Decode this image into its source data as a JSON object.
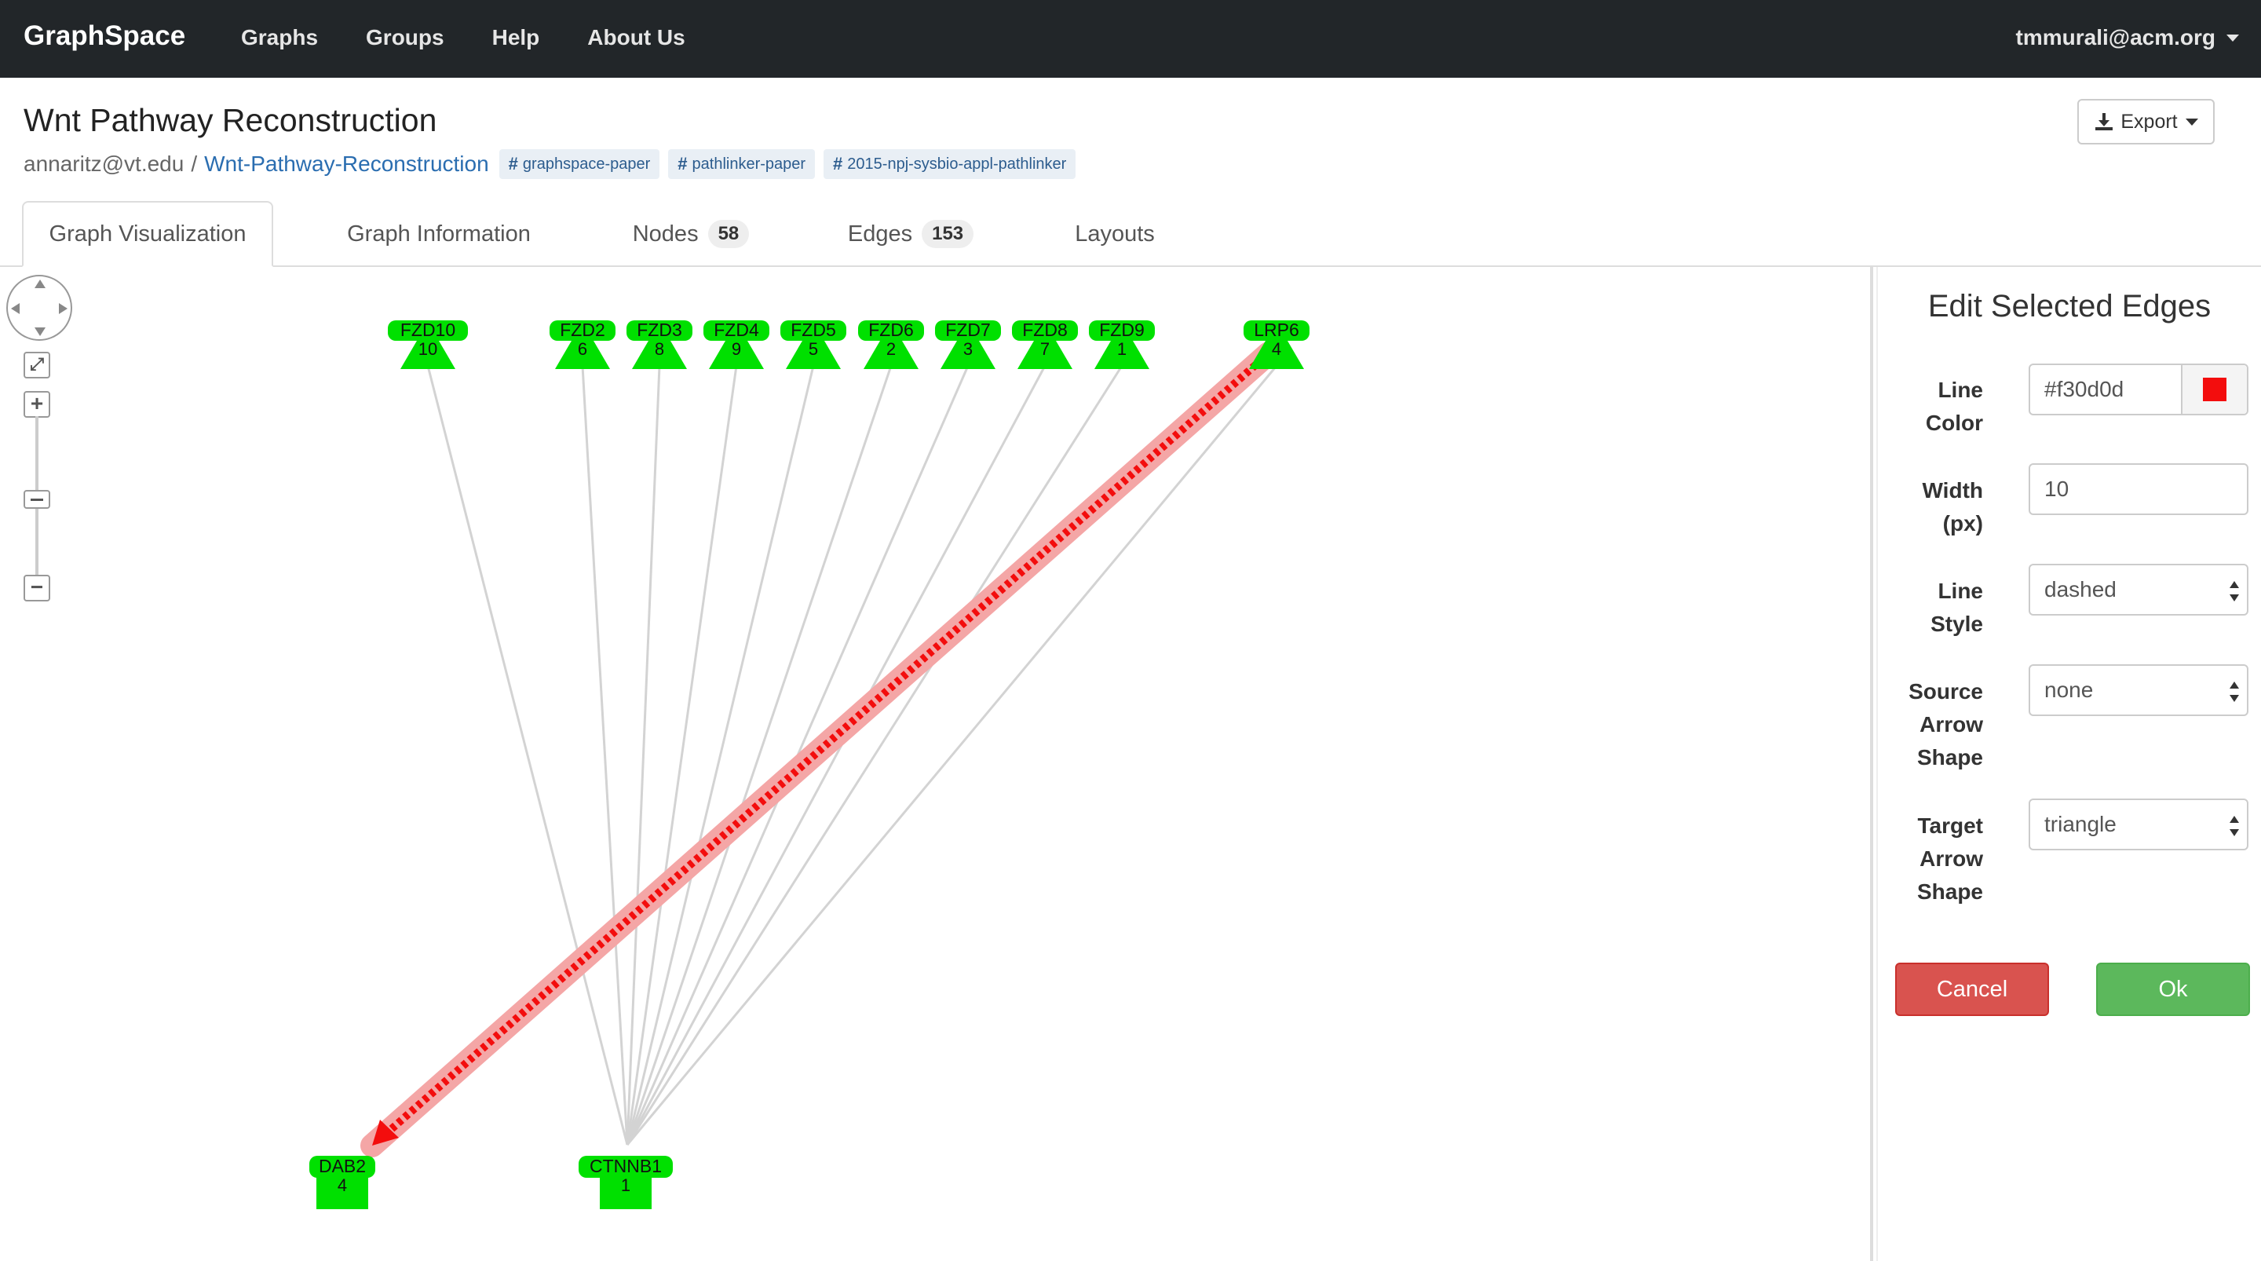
{
  "navbar": {
    "brand": "GraphSpace",
    "links": [
      "Graphs",
      "Groups",
      "Help",
      "About Us"
    ],
    "user": "tmmurali@acm.org"
  },
  "header": {
    "title": "Wnt Pathway Reconstruction",
    "owner": "annaritz@vt.edu",
    "separator": "/",
    "graph_name": "Wnt-Pathway-Reconstruction",
    "tags": [
      "graphspace-paper",
      "pathlinker-paper",
      "2015-npj-sysbio-appl-pathlinker"
    ],
    "export_label": "Export"
  },
  "tabs": [
    {
      "label": "Graph Visualization",
      "count": null
    },
    {
      "label": "Graph Information",
      "count": null
    },
    {
      "label": "Nodes",
      "count": "58"
    },
    {
      "label": "Edges",
      "count": "153"
    },
    {
      "label": "Layouts",
      "count": null
    }
  ],
  "graph": {
    "receptors": [
      {
        "name": "FZD10",
        "rank": "10"
      },
      {
        "name": "FZD2",
        "rank": "6"
      },
      {
        "name": "FZD3",
        "rank": "8"
      },
      {
        "name": "FZD4",
        "rank": "9"
      },
      {
        "name": "FZD5",
        "rank": "5"
      },
      {
        "name": "FZD6",
        "rank": "2"
      },
      {
        "name": "FZD7",
        "rank": "3"
      },
      {
        "name": "FZD8",
        "rank": "7"
      },
      {
        "name": "FZD9",
        "rank": "1"
      },
      {
        "name": "LRP6",
        "rank": "4"
      }
    ],
    "targets": [
      {
        "name": "DAB2",
        "rank": "4"
      },
      {
        "name": "CTNNB1",
        "rank": "1"
      }
    ],
    "node_color": "#00e000",
    "edge_color": "#d3d3d3",
    "selected_edge": {
      "source": "LRP6",
      "target": "DAB2",
      "color": "#f30d0d",
      "highlight": "#f4a6a6"
    }
  },
  "controls": {
    "zoom_fit": "⤢",
    "zoom_in": "+",
    "zoom_out": "−"
  },
  "panel": {
    "title": "Edit Selected Edges",
    "labels": {
      "line_color": [
        "Line",
        "Color"
      ],
      "width": [
        "Width",
        "(px)"
      ],
      "line_style": [
        "Line",
        "Style"
      ],
      "source_arrow": [
        "Source",
        "Arrow",
        "Shape"
      ],
      "target_arrow": [
        "Target",
        "Arrow",
        "Shape"
      ]
    },
    "values": {
      "line_color": "#f30d0d",
      "width": "10",
      "line_style": "dashed",
      "source_arrow": "none",
      "target_arrow": "triangle"
    },
    "cancel_label": "Cancel",
    "ok_label": "Ok"
  }
}
